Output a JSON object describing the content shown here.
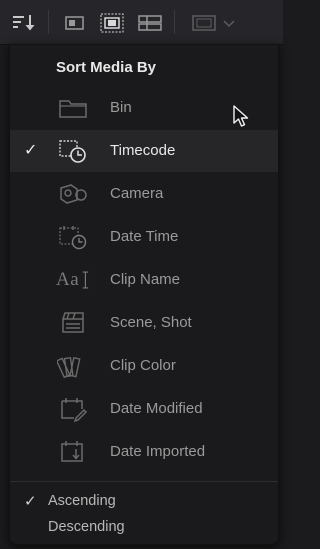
{
  "menu": {
    "title": "Sort Media By",
    "items": [
      {
        "label": "Bin",
        "icon": "folder-icon",
        "selected": false
      },
      {
        "label": "Timecode",
        "icon": "timecode-icon",
        "selected": true
      },
      {
        "label": "Camera",
        "icon": "camera-icon",
        "selected": false
      },
      {
        "label": "Date Time",
        "icon": "date-time-icon",
        "selected": false
      },
      {
        "label": "Clip Name",
        "icon": "clip-name-icon",
        "selected": false
      },
      {
        "label": "Scene, Shot",
        "icon": "clapperboard-icon",
        "selected": false
      },
      {
        "label": "Clip Color",
        "icon": "color-swatch-icon",
        "selected": false
      },
      {
        "label": "Date Modified",
        "icon": "calendar-edit-icon",
        "selected": false
      },
      {
        "label": "Date Imported",
        "icon": "calendar-import-icon",
        "selected": false
      }
    ],
    "check_mark": "✓",
    "order": [
      {
        "label": "Ascending",
        "selected": true
      },
      {
        "label": "Descending",
        "selected": false
      }
    ],
    "clip_name_glyph": "Aa"
  },
  "toolbar": {
    "sort_icon": "sort-icon",
    "view_icons": [
      "thumbnail-view-icon",
      "filmstrip-view-icon",
      "list-view-icon"
    ],
    "extra_icon": "viewer-icon"
  },
  "colors": {
    "background": "#1b1b1d",
    "menu_background": "#1a1a1c",
    "selected_row": "#262629",
    "text": "#9a9a9a",
    "text_active": "#e8e8e8"
  }
}
